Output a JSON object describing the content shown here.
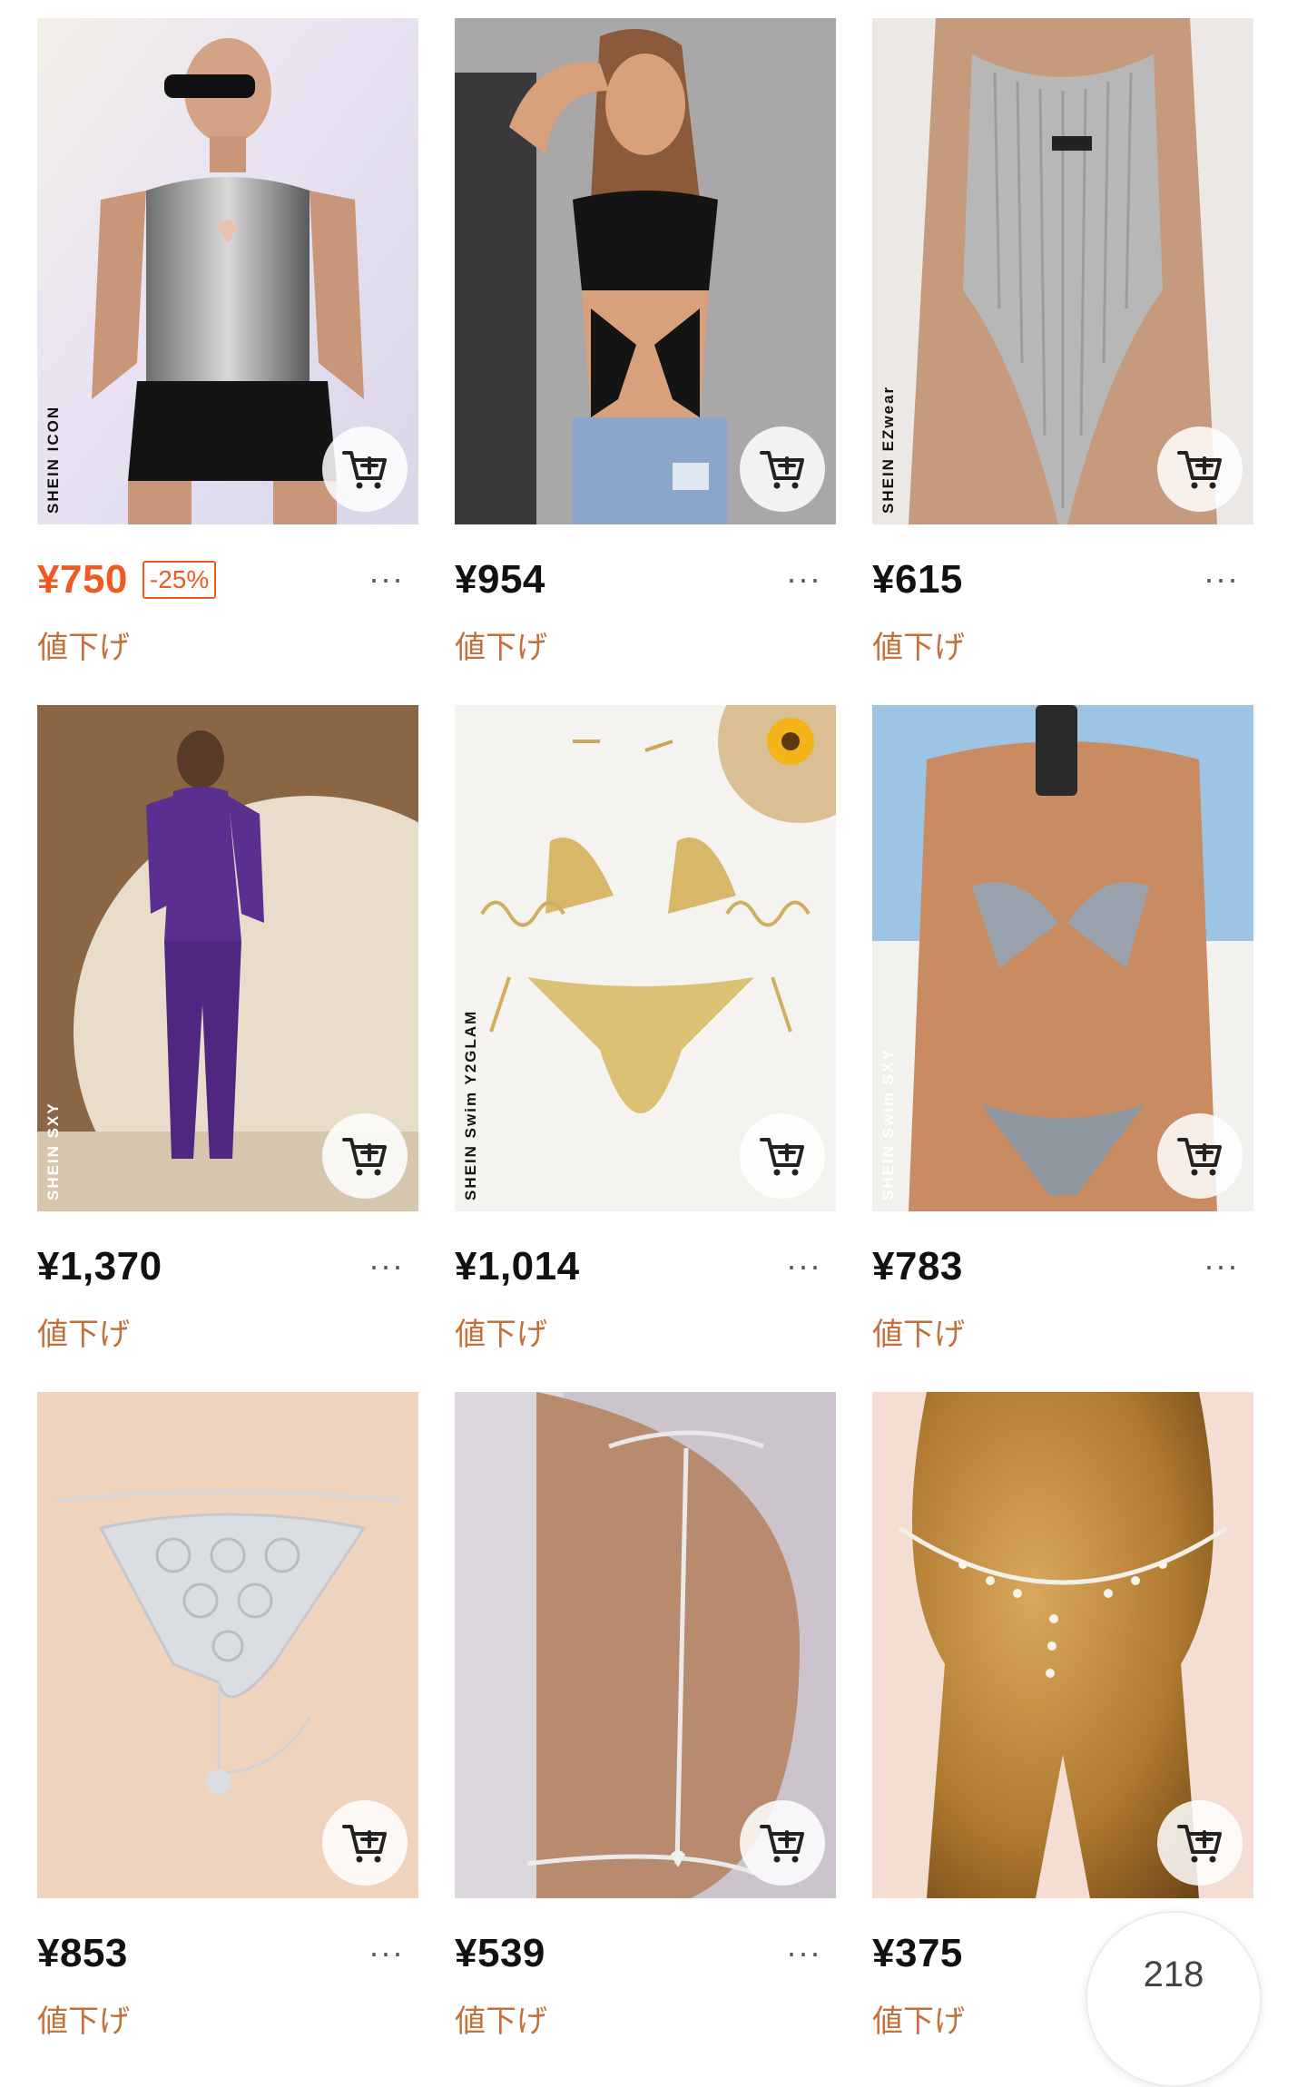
{
  "products": [
    {
      "price": "¥750",
      "discount": "-25%",
      "tag": "値下げ",
      "brand": "SHEIN ICON",
      "sale": true
    },
    {
      "price": "¥954",
      "tag": "値下げ",
      "brand": ""
    },
    {
      "price": "¥615",
      "tag": "値下げ",
      "brand": "SHEIN EZwear"
    },
    {
      "price": "¥1,370",
      "tag": "値下げ",
      "brand": "SHEIN SXY"
    },
    {
      "price": "¥1,014",
      "tag": "値下げ",
      "brand": "SHEIN Swim Y2GLAM"
    },
    {
      "price": "¥783",
      "tag": "値下げ",
      "brand": "SHEIN Swim SXY"
    },
    {
      "price": "¥853",
      "tag": "値下げ",
      "brand": ""
    },
    {
      "price": "¥539",
      "tag": "値下げ",
      "brand": ""
    },
    {
      "price": "¥375",
      "tag": "値下げ",
      "brand": ""
    }
  ],
  "more_label": "···",
  "float_badge": {
    "count": "218"
  },
  "colors": {
    "sale_price": "#f05a22",
    "tag": "#c3703a",
    "price": "#111111"
  }
}
